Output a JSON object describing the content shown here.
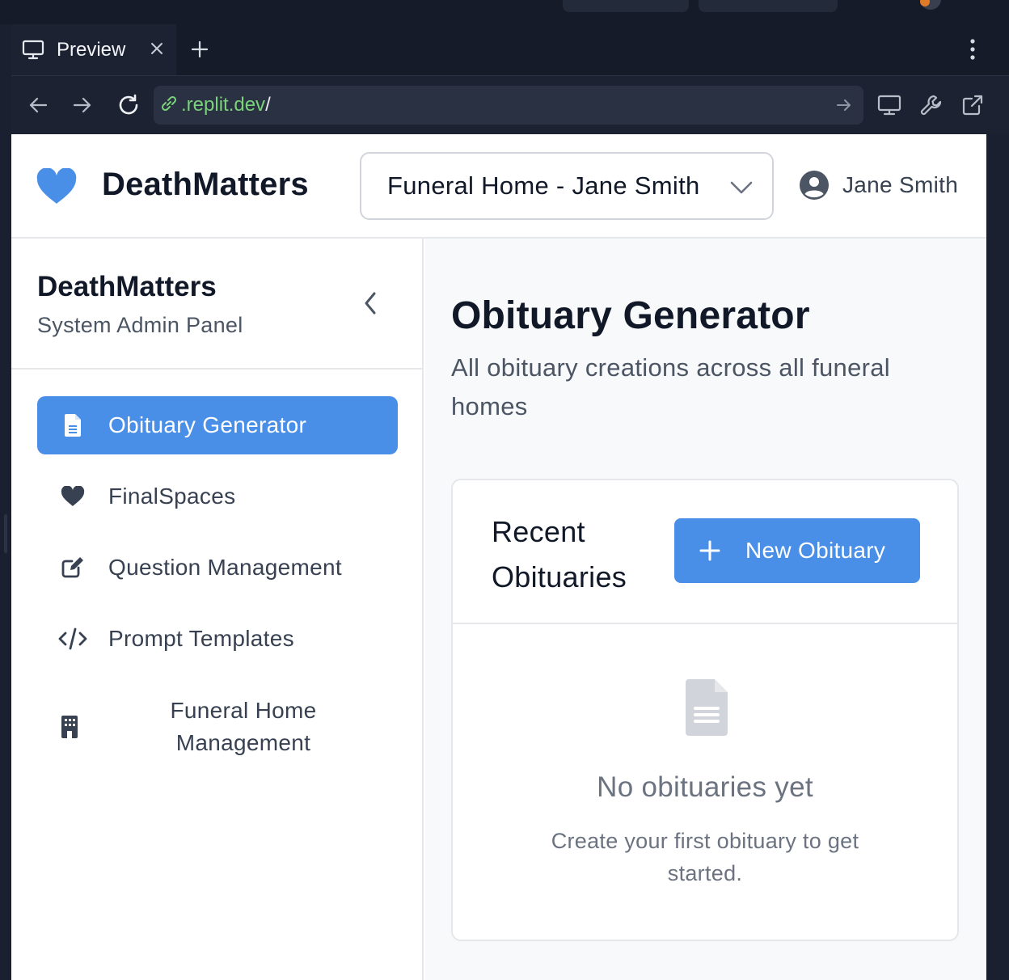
{
  "browser": {
    "tab_title": "Preview",
    "url_domain": ".replit.dev",
    "url_path": "/"
  },
  "header": {
    "brand": "DeathMatters",
    "funeral_home_selected": "Funeral Home - Jane Smith",
    "user_name": "Jane Smith"
  },
  "sidebar": {
    "title": "DeathMatters",
    "subtitle": "System Admin Panel",
    "items": [
      {
        "label": "Obituary Generator",
        "icon": "document-icon",
        "active": true
      },
      {
        "label": "FinalSpaces",
        "icon": "heart-icon",
        "active": false
      },
      {
        "label": "Question Management",
        "icon": "edit-icon",
        "active": false
      },
      {
        "label": "Prompt Templates",
        "icon": "code-icon",
        "active": false
      },
      {
        "label": "Funeral Home Management",
        "icon": "building-icon",
        "active": false
      }
    ]
  },
  "main": {
    "title": "Obituary Generator",
    "subtitle": "All obituary creations across all funeral homes",
    "card": {
      "title": "Recent Obituaries",
      "new_button": "New Obituary",
      "empty_title": "No obituaries yet",
      "empty_subtitle": "Create your first obituary to get started."
    }
  },
  "colors": {
    "accent": "#4a8fe7",
    "chrome_bg": "#1c2231",
    "url_green": "#7ad27a"
  }
}
